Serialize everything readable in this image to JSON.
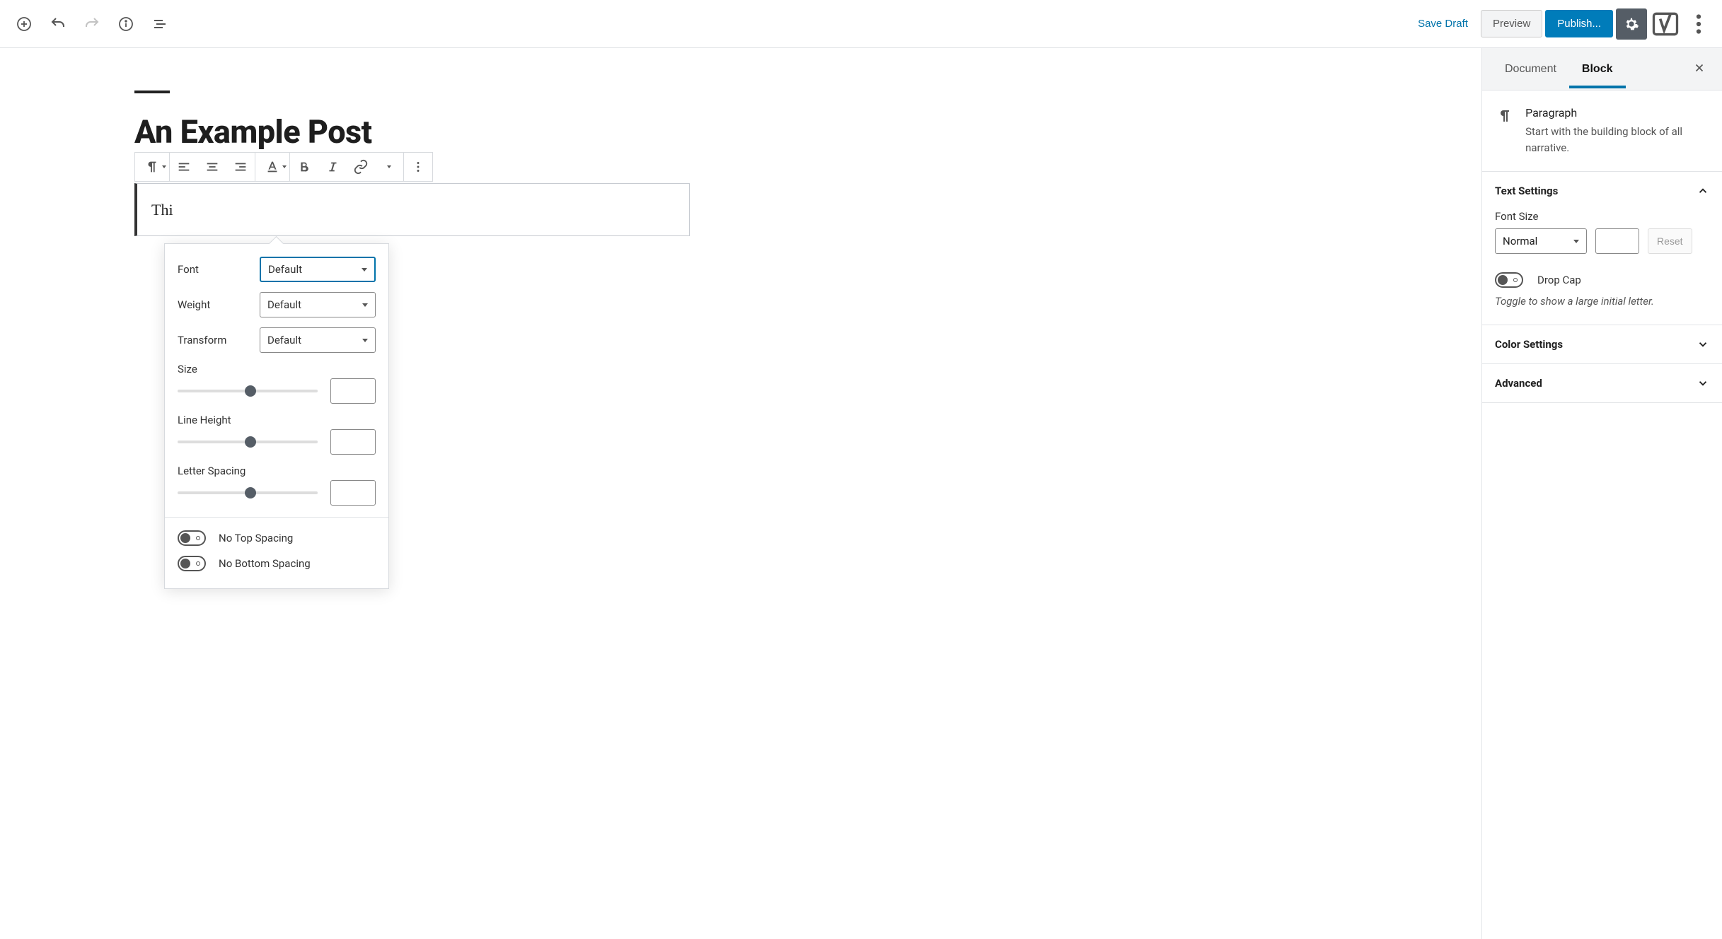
{
  "topbar": {
    "save_draft": "Save Draft",
    "preview": "Preview",
    "publish": "Publish..."
  },
  "post": {
    "title": "An Example Post",
    "paragraph_visible": "Thi"
  },
  "popover": {
    "font_label": "Font",
    "font_value": "Default",
    "weight_label": "Weight",
    "weight_value": "Default",
    "transform_label": "Transform",
    "transform_value": "Default",
    "size_label": "Size",
    "line_height_label": "Line Height",
    "letter_spacing_label": "Letter Spacing",
    "no_top_spacing": "No Top Spacing",
    "no_bottom_spacing": "No Bottom Spacing"
  },
  "sidebar": {
    "tabs": {
      "document": "Document",
      "block": "Block"
    },
    "block_info": {
      "title": "Paragraph",
      "desc": "Start with the building block of all narrative."
    },
    "text_settings": {
      "title": "Text Settings",
      "font_size_label": "Font Size",
      "font_size_value": "Normal",
      "reset": "Reset",
      "drop_cap": "Drop Cap",
      "drop_cap_hint": "Toggle to show a large initial letter."
    },
    "color_settings": "Color Settings",
    "advanced": "Advanced"
  }
}
